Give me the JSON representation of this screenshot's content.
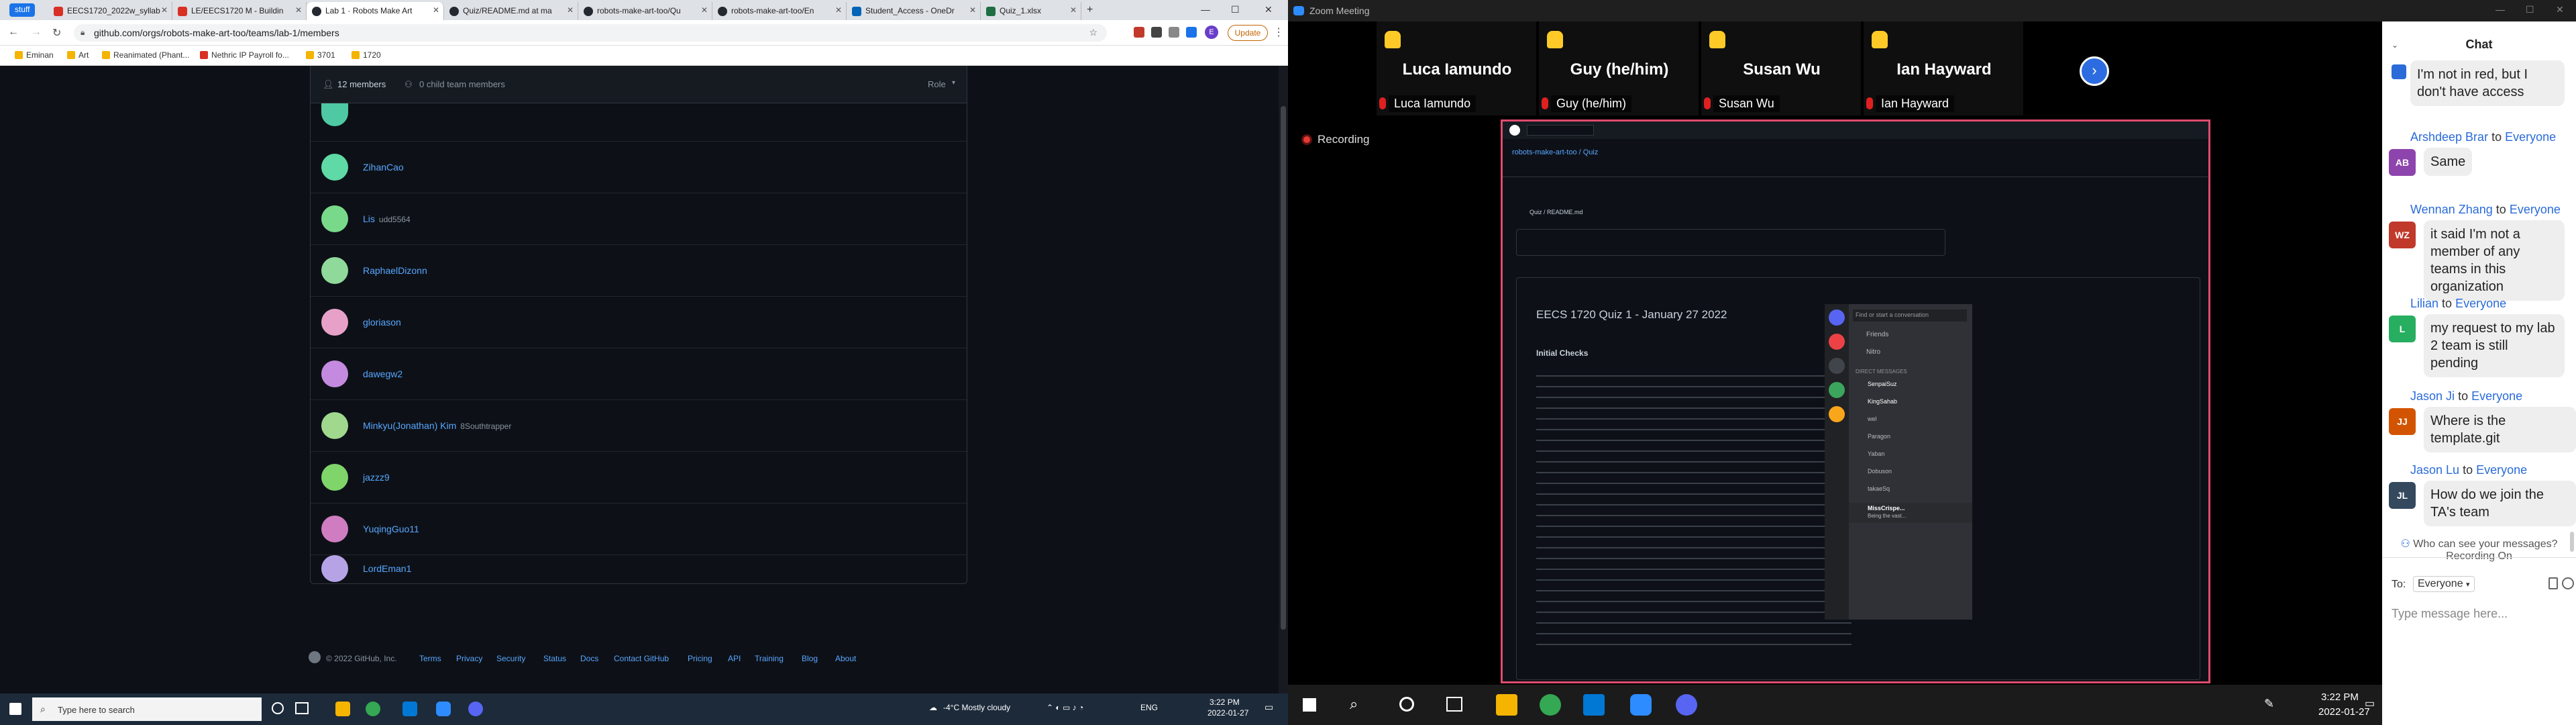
{
  "browser": {
    "tab_group": "stuff",
    "tabs": [
      {
        "label": "EECS1720_2022w_syllab"
      },
      {
        "label": "LE/EECS1720 M - Buildin"
      },
      {
        "label": "Lab 1 · Robots Make Art"
      },
      {
        "label": "Quiz/README.md at ma"
      },
      {
        "label": "robots-make-art-too/Qu"
      },
      {
        "label": "robots-make-art-too/En"
      },
      {
        "label": "Student_Access - OneDr"
      },
      {
        "label": "Quiz_1.xlsx"
      }
    ],
    "url": "github.com/orgs/robots-make-art-too/teams/lab-1/members",
    "update_label": "Update",
    "profile_initial": "E",
    "bookmarks": [
      "Eminan",
      "Art",
      "Reanimated (Phant...",
      "Nethric IP Payroll fo...",
      "3701",
      "1720"
    ]
  },
  "github": {
    "members_count": "12 members",
    "child_teams": "0 child team members",
    "role_label": "Role",
    "members": [
      {
        "name": "ZihanCao",
        "sub": ""
      },
      {
        "name": "Lis",
        "sub": "udd5564"
      },
      {
        "name": "RaphaelDizonn",
        "sub": ""
      },
      {
        "name": "gloriason",
        "sub": ""
      },
      {
        "name": "dawegw2",
        "sub": ""
      },
      {
        "name": "Minkyu(Jonathan) Kim",
        "sub": "8Southtrapper"
      },
      {
        "name": "jazzz9",
        "sub": ""
      },
      {
        "name": "YuqingGuo11",
        "sub": ""
      },
      {
        "name": "LordEman1",
        "sub": ""
      }
    ],
    "footer": {
      "copyright": "© 2022 GitHub, Inc.",
      "links": [
        "Terms",
        "Privacy",
        "Security",
        "Status",
        "Docs",
        "Contact GitHub",
        "Pricing",
        "API",
        "Training",
        "Blog",
        "About"
      ]
    }
  },
  "taskbar_left": {
    "search_placeholder": "Type here to search",
    "weather": "-4°C  Mostly cloudy",
    "lang": "ENG",
    "time": "3:22 PM",
    "date": "2022-01-27"
  },
  "zoom": {
    "title": "Zoom Meeting",
    "recording_label": "Recording",
    "participants": [
      {
        "name": "Luca Iamundo",
        "label": "Luca Iamundo"
      },
      {
        "name": "Guy (he/him)",
        "label": "Guy (he/him)"
      },
      {
        "name": "Susan Wu",
        "label": "Susan Wu"
      },
      {
        "name": "Ian Hayward",
        "label": "Ian Hayward"
      }
    ],
    "shared_screen": {
      "repo_path": "robots-make-art-too / Quiz",
      "file_path": "Quiz / README.md",
      "doc_title": "EECS 1720 Quiz 1 - January 27 2022",
      "section": "Initial Checks",
      "discord_search": "Find or start a conversation",
      "discord_friends": "Friends",
      "discord_nitro": "Nitro",
      "discord_dm_header": "DIRECT MESSAGES",
      "discord_dms": [
        "SenpaiSuz",
        "KingSahab",
        "wel",
        "Paragon",
        "Yaban",
        "Dobuson",
        "takaeSq"
      ],
      "discord_user": "MissCrispe...",
      "discord_user_status": "Being the vast..."
    },
    "chat": {
      "header": "Chat",
      "messages": [
        {
          "from": "",
          "to": "",
          "initials": "",
          "color": "#2a6bd9",
          "text": "I'm not in red, but I don't have access"
        },
        {
          "from": "Arshdeep Brar",
          "to": "Everyone",
          "initials": "AB",
          "color": "#8e44ad",
          "text": "Same"
        },
        {
          "from": "Wennan Zhang",
          "to": "Everyone",
          "initials": "WZ",
          "color": "#c0392b",
          "text": "it said I'm not a member of any teams in this organization"
        },
        {
          "from": "Lilian",
          "to": "Everyone",
          "initials": "L",
          "color": "#27ae60",
          "text": "my request to my lab 2 team is still pending"
        },
        {
          "from": "Jason Ji",
          "to": "Everyone",
          "initials": "JJ",
          "color": "#d35400",
          "text": "Where is the template.git"
        },
        {
          "from": "Jason Lu",
          "to": "Everyone",
          "initials": "JL",
          "color": "#34495e",
          "text": "How do we join the TA's team"
        }
      ],
      "privacy_note": "Who can see your messages? Recording On",
      "to_label": "To:",
      "to_value": "Everyone",
      "input_placeholder": "Type message here..."
    }
  },
  "taskbar_right": {
    "time": "3:22 PM",
    "date": "2022-01-27"
  }
}
